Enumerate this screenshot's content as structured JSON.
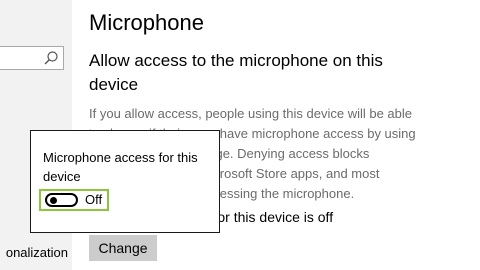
{
  "sidebar": {
    "search": {
      "placeholder": "",
      "icon": "search-icon"
    },
    "items": [
      {
        "label": "onalization"
      }
    ]
  },
  "main": {
    "title": "Microphone",
    "section_heading": "Allow access to the microphone on this device",
    "description": "If you allow access, people using this device will be able to choose if their apps have microphone access by using the settings on this page. Denying access blocks Windows features, Microsoft Store apps, and most desktop apps from accessing the microphone.",
    "status": "Microphone access for this device is off",
    "change_button": "Change"
  },
  "dialog": {
    "label": "Microphone access for this device",
    "toggle_state": "Off",
    "toggle_on": false,
    "highlight_color": "#8cc63f"
  }
}
